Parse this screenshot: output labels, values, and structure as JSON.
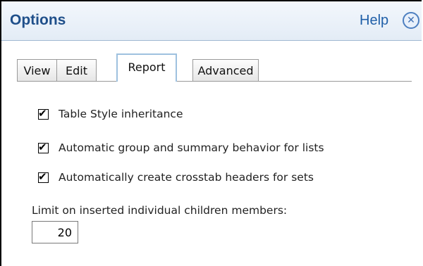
{
  "header": {
    "title": "Options",
    "help_label": "Help",
    "close_glyph": "✕"
  },
  "tabs": [
    {
      "label": "View",
      "active": false
    },
    {
      "label": "Edit",
      "active": false
    },
    {
      "label": "Report",
      "active": true
    },
    {
      "label": "Advanced",
      "active": false
    }
  ],
  "report": {
    "options": [
      {
        "label": "Table Style inheritance",
        "checked": true
      },
      {
        "label": "Automatic group and summary behavior for lists",
        "checked": true
      },
      {
        "label": "Automatically create crosstab headers for sets",
        "checked": true
      }
    ],
    "checkmark_glyph": "✔",
    "limit_label": "Limit on inserted individual children members:",
    "limit_value": "20"
  },
  "colors": {
    "title": "#1f4f8a",
    "help_link": "#1f5fa8",
    "active_tab_border": "#9ec1df"
  }
}
